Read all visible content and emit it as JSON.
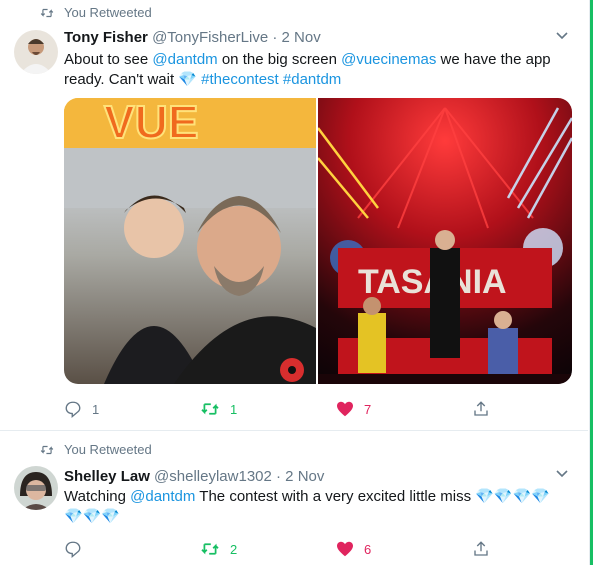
{
  "tweets": [
    {
      "retweet_label": "You Retweeted",
      "name": "Tony Fisher",
      "handle": "@TonyFisherLive",
      "date": "· 2 Nov",
      "text_parts": [
        "About to see ",
        "@dantdm",
        " on the big screen ",
        "@vuecinemas",
        " we have the app ready. Can't wait ",
        "💎",
        " ",
        "#thecontest",
        " ",
        "#dantdm"
      ],
      "replies": "1",
      "retweets": "1",
      "likes": "7"
    },
    {
      "retweet_label": "You Retweeted",
      "name": "Shelley Law",
      "handle": "@shelleylaw1302",
      "date": "· 2 Nov",
      "text_parts": [
        "Watching ",
        "@dantdm",
        " The contest with a very excited little miss ",
        "💎💎💎💎💎💎💎"
      ],
      "replies": "",
      "retweets": "2",
      "likes": "6"
    }
  ],
  "colors": {
    "link": "#1b95e0",
    "retweet_active": "#17bf63",
    "like_active": "#e0245e",
    "muted": "#657786"
  }
}
